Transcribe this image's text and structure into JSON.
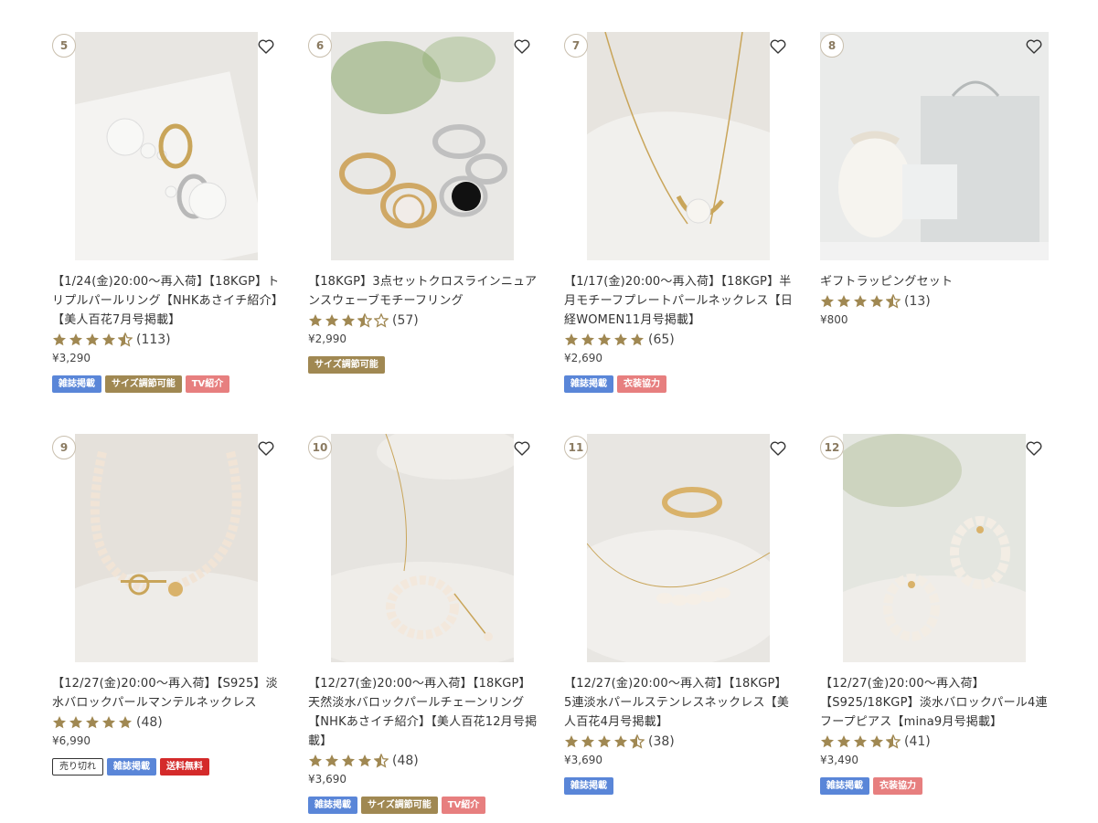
{
  "products": [
    {
      "rank": "5",
      "title": "【1/24(金)20:00〜再入荷】【18KGP】トリプルパールリング【NHKあさイチ紹介】【美人百花7月号掲載】",
      "rating": 4.5,
      "count": "(113)",
      "price": "¥3,290",
      "tags": [
        {
          "label": "雑誌掲載",
          "style": "blue"
        },
        {
          "label": "サイズ調節可能",
          "style": "gold"
        },
        {
          "label": "TV紹介",
          "style": "pink"
        }
      ],
      "image": "pearl-rings",
      "photo_bg": "#e8e6e2"
    },
    {
      "rank": "6",
      "title": "【18KGP】3点セットクロスラインニュアンスウェーブモチーフリング",
      "rating": 3.5,
      "count": "(57)",
      "price": "¥2,990",
      "tags": [
        {
          "label": "サイズ調節可能",
          "style": "gold"
        }
      ],
      "image": "cross-rings",
      "photo_bg": "#e9e8e5"
    },
    {
      "rank": "7",
      "title": "【1/17(金)20:00〜再入荷】【18KGP】半月モチーフプレートパールネックレス【日経WOMEN11月号掲載】",
      "rating": 5,
      "count": "(65)",
      "price": "¥2,690",
      "tags": [
        {
          "label": "雑誌掲載",
          "style": "blue"
        },
        {
          "label": "衣装協力",
          "style": "pink"
        }
      ],
      "image": "half-moon-necklace",
      "photo_bg": "#e7e4df"
    },
    {
      "rank": "8",
      "title": "ギフトラッピングセット",
      "rating": 4.5,
      "count": "(13)",
      "price": "¥800",
      "tags": [],
      "image": "gift-set",
      "photo_bg": "#eaebea"
    },
    {
      "rank": "9",
      "title": "【12/27(金)20:00〜再入荷】【S925】淡水バロックパールマンテルネックレス",
      "rating": 5,
      "count": "(48)",
      "price": "¥6,990",
      "tags": [
        {
          "label": "売り切れ",
          "style": "out"
        },
        {
          "label": "雑誌掲載",
          "style": "blue"
        },
        {
          "label": "送料無料",
          "style": "red"
        }
      ],
      "image": "baroque-necklace",
      "photo_bg": "#e5e1db"
    },
    {
      "rank": "10",
      "title": "【12/27(金)20:00〜再入荷】【18KGP】天然淡水バロックパールチェーンリング【NHKあさイチ紹介】【美人百花12月号掲載】",
      "rating": 4.5,
      "count": "(48)",
      "price": "¥3,690",
      "tags": [
        {
          "label": "雑誌掲載",
          "style": "blue"
        },
        {
          "label": "サイズ調節可能",
          "style": "gold"
        },
        {
          "label": "TV紹介",
          "style": "pink"
        }
      ],
      "image": "chain-ring",
      "photo_bg": "#e6e4e0"
    },
    {
      "rank": "11",
      "title": "【12/27(金)20:00〜再入荷】【18KGP】5連淡水パールステンレスネックレス【美人百花4月号掲載】",
      "rating": 4.5,
      "count": "(38)",
      "price": "¥3,690",
      "tags": [
        {
          "label": "雑誌掲載",
          "style": "blue"
        }
      ],
      "image": "five-pearl-necklace",
      "photo_bg": "#e8e6e2"
    },
    {
      "rank": "12",
      "title": "【12/27(金)20:00〜再入荷】【S925/18KGP】淡水バロックパール4連フープピアス【mina9月号掲載】",
      "rating": 4.5,
      "count": "(41)",
      "price": "¥3,490",
      "tags": [
        {
          "label": "雑誌掲載",
          "style": "blue"
        },
        {
          "label": "衣装協力",
          "style": "pink"
        }
      ],
      "image": "hoop-earrings",
      "photo_bg": "#e4e6e0"
    }
  ],
  "colors": {
    "star": "#a08852",
    "rank_border": "#c9bfae",
    "tag_blue": "#5a86d8",
    "tag_gold": "#a08852",
    "tag_pink": "#e77f7f",
    "tag_red": "#d42a2a"
  },
  "icons": {
    "favorite": "heart-outline-icon",
    "rating": "star-icon"
  }
}
